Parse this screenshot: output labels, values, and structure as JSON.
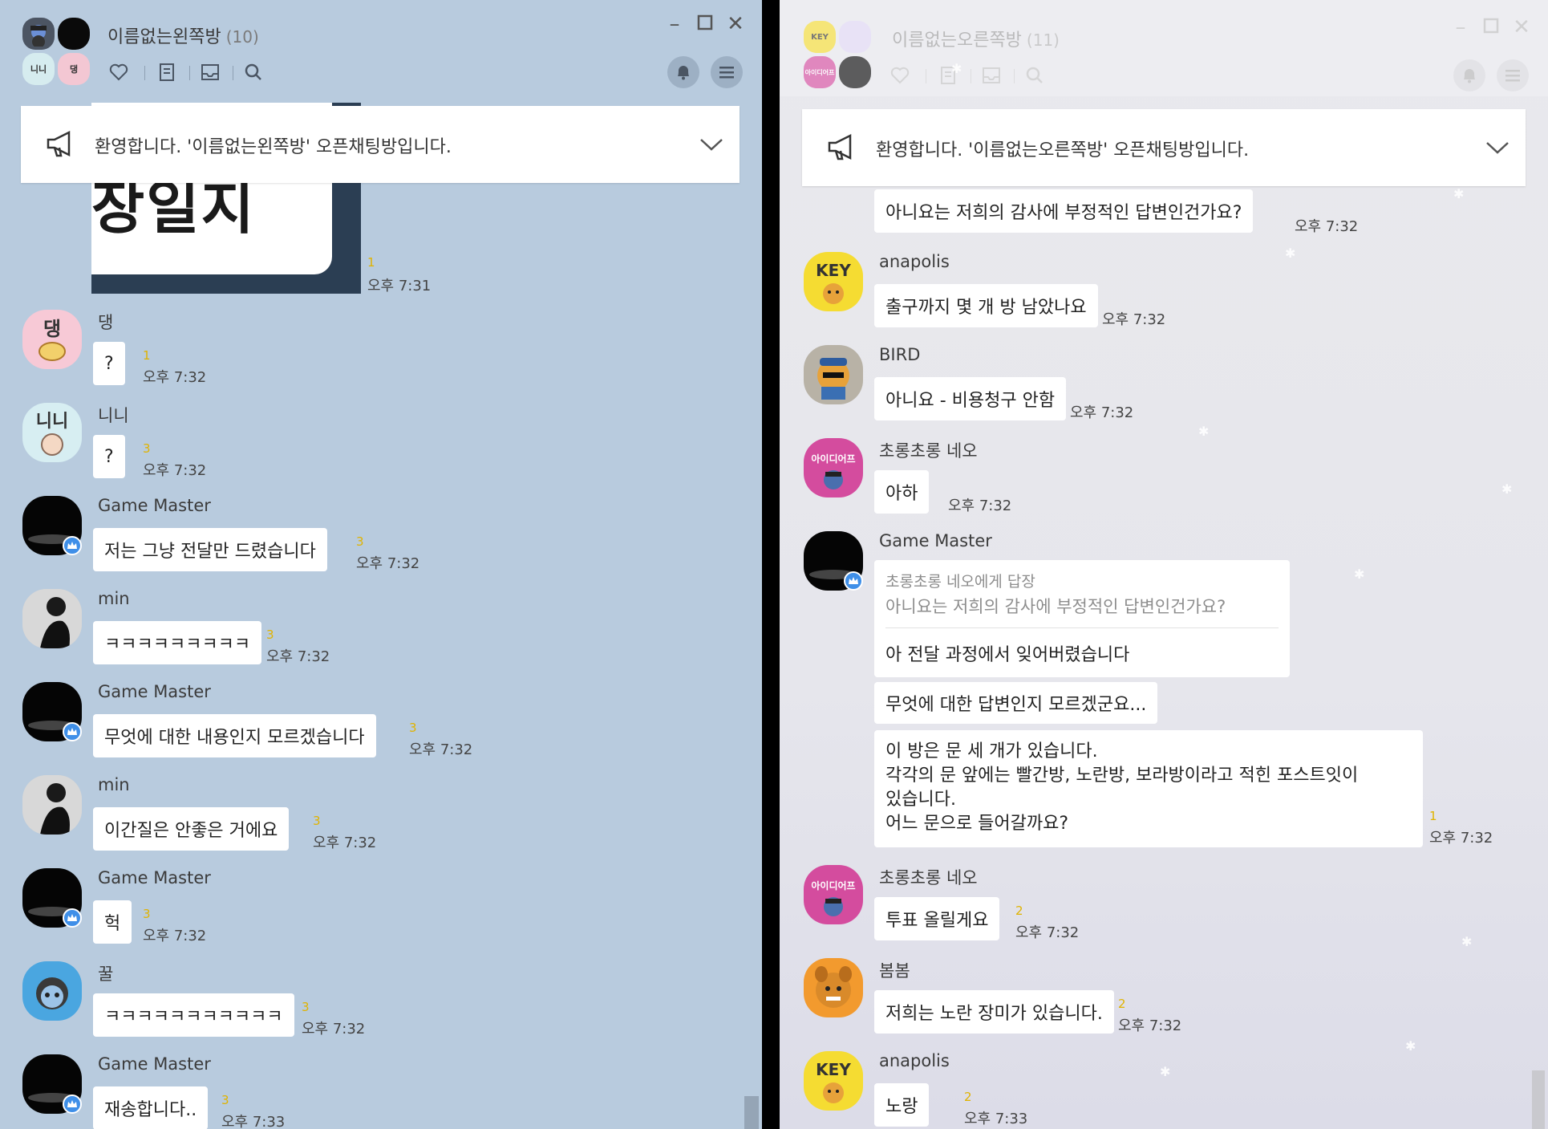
{
  "left": {
    "title": "이름없는왼쪽방",
    "count": "(10)",
    "header_avatars": [
      "니니",
      "댕"
    ],
    "notice": "환영합니다. '이름없는왼쪽방' 오픈채팅방입니다.",
    "image_msg": {
      "text": "장일지",
      "unread": "1",
      "time": "오후 7:31"
    },
    "messages": [
      {
        "sender": "댕",
        "text": "?",
        "unread": "1",
        "time": "오후 7:32"
      },
      {
        "sender": "니니",
        "text": "?",
        "unread": "3",
        "time": "오후 7:32"
      },
      {
        "sender": "Game Master",
        "text": "저는 그냥 전달만 드렸습니다",
        "unread": "3",
        "time": "오후 7:32"
      },
      {
        "sender": "min",
        "text": "ㅋㅋㅋㅋㅋㅋㅋㅋㅋ",
        "unread": "3",
        "time": "오후 7:32"
      },
      {
        "sender": "Game Master",
        "text": "무엇에 대한 내용인지 모르겠습니다",
        "unread": "3",
        "time": "오후 7:32"
      },
      {
        "sender": "min",
        "text": "이간질은 안좋은 거에요",
        "unread": "3",
        "time": "오후 7:32"
      },
      {
        "sender": "Game Master",
        "text": "헉",
        "unread": "3",
        "time": "오후 7:32"
      },
      {
        "sender": "꿀",
        "text": "ㅋㅋㅋㅋㅋㅋㅋㅋㅋㅋㅋ",
        "unread": "3",
        "time": "오후 7:32"
      },
      {
        "sender": "Game Master",
        "text": "재송합니다..",
        "unread": "3",
        "time": "오후 7:33"
      }
    ]
  },
  "right": {
    "title": "이름없는오른쪽방",
    "count": "(11)",
    "header_avatars": [
      "KEY",
      "아이디어프"
    ],
    "notice": "환영합니다. '이름없는오른쪽방' 오픈채팅방입니다.",
    "top_cont": {
      "text": "아니요는 저희의 감사에 부정적인 답변인건가요?",
      "time": "오후 7:32"
    },
    "messages": [
      {
        "sender": "anapolis",
        "avatar_text": "KEY",
        "text": "출구까지 몇 개 방 남았나요",
        "time": "오후 7:32"
      },
      {
        "sender": "BIRD",
        "text": "아니요 - 비용청구 안함",
        "time": "오후 7:32"
      },
      {
        "sender": "초롱초롱 네오",
        "avatar_text": "아이디어프",
        "text": "아하",
        "time": "오후 7:32"
      }
    ],
    "gm": {
      "sender": "Game Master",
      "reply_to": "초롱초롱 네오에게 답장",
      "quoted": "아니요는 저희의 감사에 부정적인 답변인건가요?",
      "reply_text": "아 전달 과정에서 잊어버렸습니다",
      "text2": "무엇에 대한 답변인지 모르겠군요...",
      "lines": [
        "이 방은 문 세 개가 있습니다.",
        "각각의 문 앞에는 빨간방, 노란방, 보라방이라고 적힌 포스트잇이",
        "있습니다.",
        "어느 문으로 들어갈까요?"
      ],
      "unread": "1",
      "time": "오후 7:32"
    },
    "messages2": [
      {
        "sender": "초롱초롱 네오",
        "avatar_text": "아이디어프",
        "text": "투표 올릴게요",
        "unread": "2",
        "time": "오후 7:32"
      },
      {
        "sender": "봄봄",
        "text": "저희는 노란 장미가 있습니다.",
        "unread": "2",
        "time": "오후 7:32"
      },
      {
        "sender": "anapolis",
        "avatar_text": "KEY",
        "text": "노랑",
        "unread": "2",
        "time": "오후 7:33"
      }
    ]
  },
  "colors": {
    "left_bg": "#b8cbde",
    "right_bg": "#e8e8ec",
    "unread": "#e0b300",
    "crown": "#3f8fe8",
    "key_yellow": "#f5dc32",
    "neo_pink": "#d44c9e"
  },
  "icons": [
    "heart-icon",
    "note-icon",
    "inbox-icon",
    "search-icon",
    "bell-icon",
    "menu-icon",
    "megaphone-icon",
    "chevron-down-icon",
    "minimize-icon",
    "maximize-icon",
    "close-icon",
    "crown-icon"
  ]
}
